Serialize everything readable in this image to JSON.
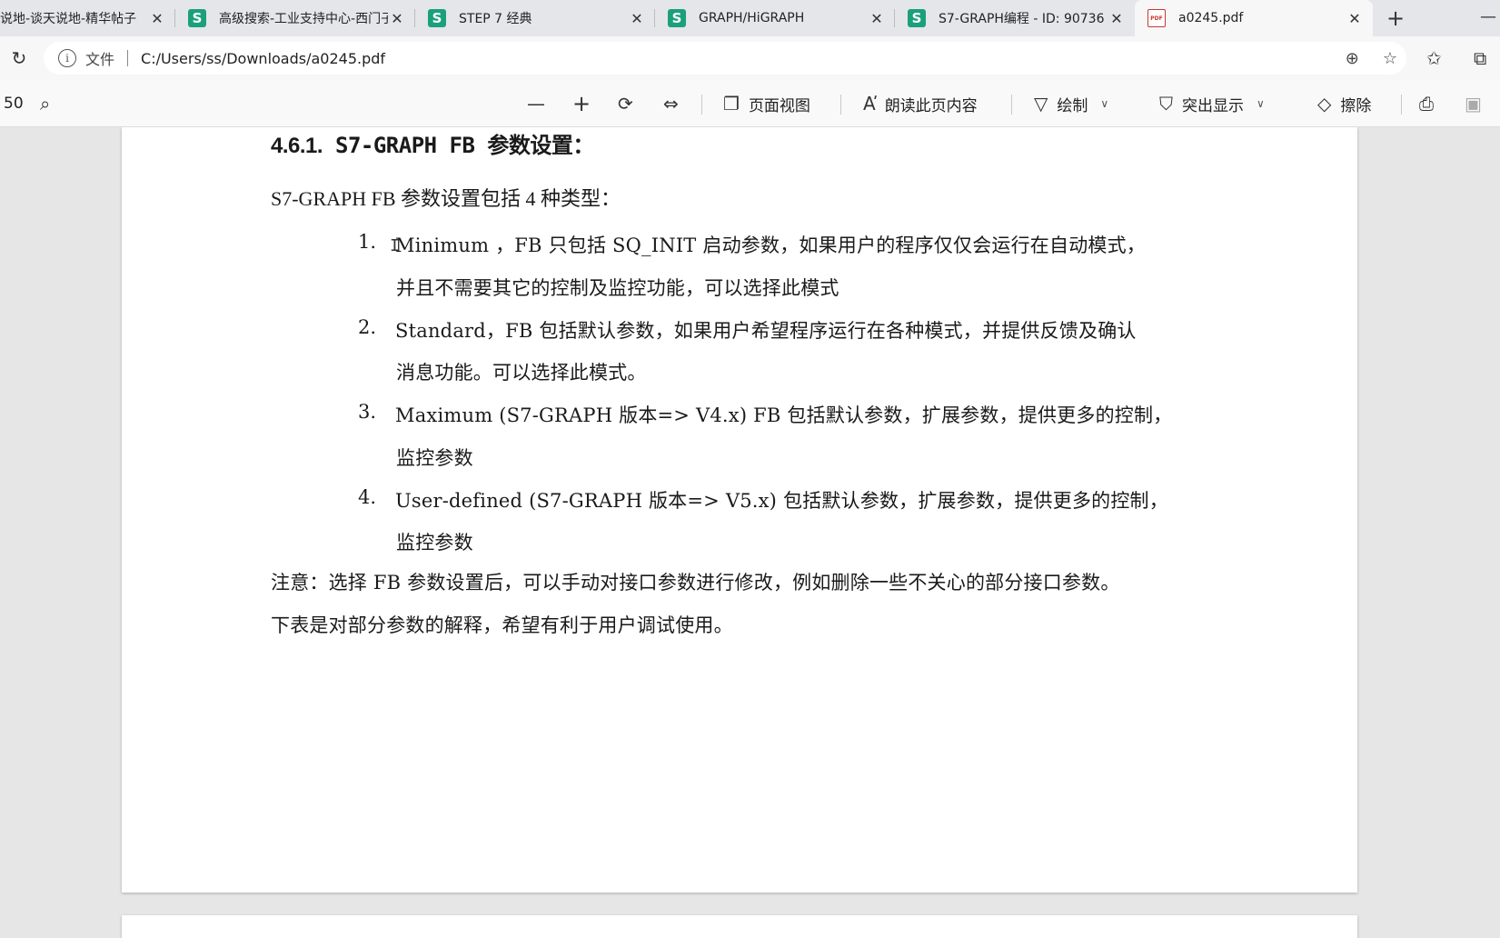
{
  "tabs": [
    {
      "title": "说地-谈天说地-精华帖子",
      "favicon": "s-logo-icon"
    },
    {
      "title": "高级搜索-工业支持中心-西门子",
      "favicon": "s-logo-icon"
    },
    {
      "title": "STEP 7 经典",
      "favicon": "s-logo-icon"
    },
    {
      "title": "GRAPH/HiGRAPH",
      "favicon": "s-logo-icon"
    },
    {
      "title": "S7-GRAPH编程 - ID: 90736",
      "favicon": "s-logo-icon"
    },
    {
      "title": "a0245.pdf",
      "favicon": "pdf-icon",
      "active": true
    }
  ],
  "tab_close_glyph": "✕",
  "new_tab_glyph": "+",
  "favicon_letter": "S",
  "pdf_favicon_label": "PDF",
  "address": {
    "scheme_label": "文件",
    "url": "C:/Users/ss/Downloads/a0245.pdf",
    "info_glyph": "i"
  },
  "pdf_toolbar": {
    "page_number": "50",
    "zoom_out_glyph": "—",
    "zoom_in_glyph": "+",
    "page_view_label": "页面视图",
    "read_aloud_label": "朗读此页内容",
    "draw_label": "绘制",
    "highlight_label": "突出显示",
    "erase_label": "擦除"
  },
  "document": {
    "heading_number": "4.6.1.",
    "heading_text": "S7-GRAPH FB 参数设置：",
    "intro": "S7-GRAPH FB 参数设置包括 4 种类型：",
    "list": [
      {
        "num": "1.",
        "lines": [
          "Minimum ，FB 只包括 SQ_INIT 启动参数，如果用户的程序仅仅会运行在自动模式，",
          "并且不需要其它的控制及监控功能，可以选择此模式"
        ]
      },
      {
        "num": "2.",
        "lines": [
          "Standard，FB 包括默认参数，如果用户希望程序运行在各种模式，并提供反馈及确认",
          "消息功能。可以选择此模式。"
        ]
      },
      {
        "num": "3.",
        "lines": [
          " Maximum (S7-GRAPH 版本=> V4.x) FB 包括默认参数，扩展参数，提供更多的控制，",
          "监控参数"
        ]
      },
      {
        "num": "4.",
        "lines": [
          "User-defined (S7-GRAPH 版本=> V5.x) 包括默认参数，扩展参数，提供更多的控制，",
          "监控参数"
        ]
      }
    ],
    "note_line1": "注意：选择 FB 参数设置后，可以手动对接口参数进行修改，例如删除一些不关心的部分接口参数。",
    "note_line2": "下表是对部分参数的解释，希望有利于用户调试使用。"
  }
}
